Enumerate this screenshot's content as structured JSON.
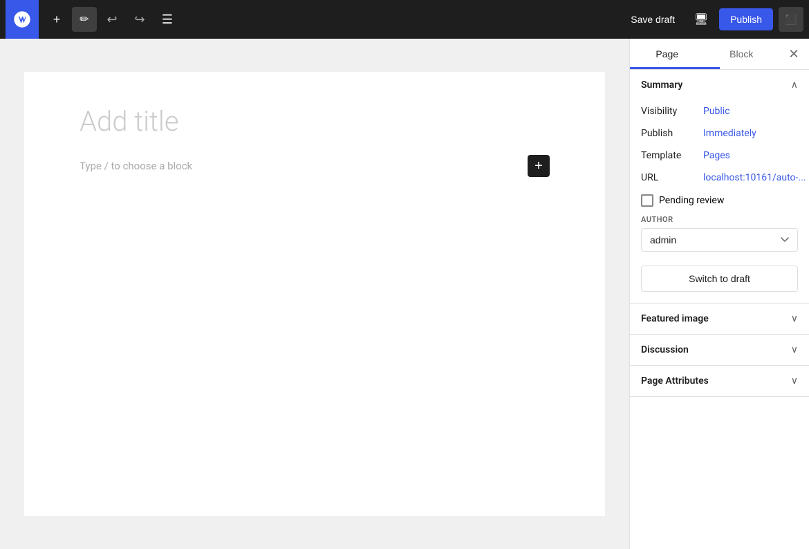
{
  "toolbar": {
    "wp_logo": "W",
    "add_block_label": "+",
    "tool_label": "✏",
    "undo_label": "←",
    "redo_label": "→",
    "list_view_label": "≡",
    "save_draft_label": "Save draft",
    "preview_label": "🖥",
    "publish_label": "Publish",
    "settings_label": "⬛"
  },
  "sidebar": {
    "tab_page_label": "Page",
    "tab_block_label": "Block",
    "close_icon": "✕",
    "active_tab": "Page"
  },
  "summary": {
    "title": "Summary",
    "collapse_icon": "∧",
    "visibility_label": "Visibility",
    "visibility_value": "Public",
    "publish_label": "Publish",
    "publish_value": "Immediately",
    "template_label": "Template",
    "template_value": "Pages",
    "url_label": "URL",
    "url_value": "localhost:10161/auto-...",
    "pending_review_label": "Pending review",
    "author_label": "AUTHOR",
    "author_value": "admin",
    "switch_draft_label": "Switch to draft"
  },
  "featured_image": {
    "title": "Featured image",
    "expand_icon": "∨"
  },
  "discussion": {
    "title": "Discussion",
    "expand_icon": "∨"
  },
  "page_attributes": {
    "title": "Page Attributes",
    "expand_icon": "∨"
  },
  "editor": {
    "title_placeholder": "Add title",
    "block_placeholder": "Type / to choose a block",
    "add_block_label": "+"
  }
}
